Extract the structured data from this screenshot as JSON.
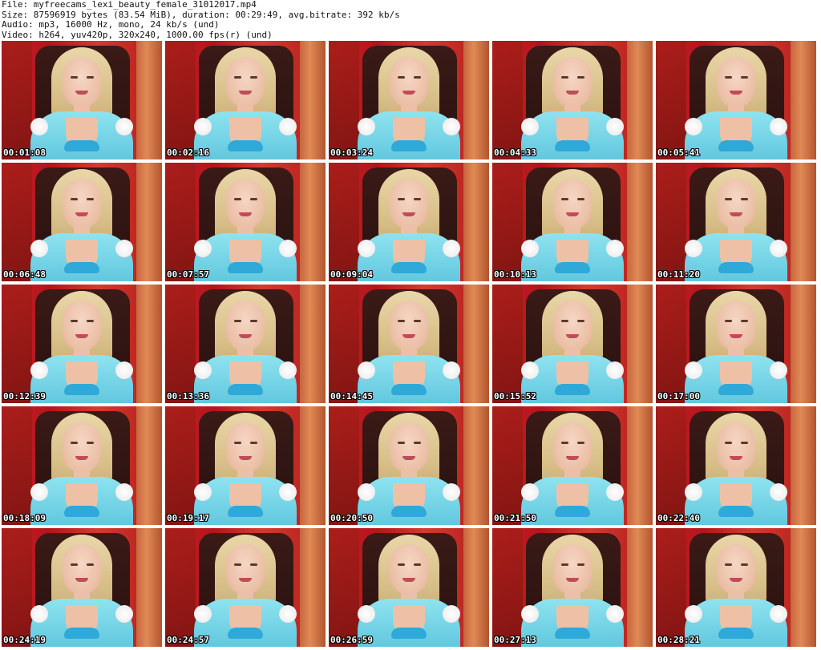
{
  "header": {
    "file": "File: myfreecams_lexi_beauty_female_31012017.mp4",
    "size": "Size: 87596919 bytes (83.54 MiB), duration: 00:29:49, avg.bitrate: 392 kb/s",
    "audio": "Audio: mp3, 16000 Hz, mono, 24 kb/s (und)",
    "video": "Video: h264, yuv420p, 320x240, 1000.00 fps(r) (und)"
  },
  "thumbnails": [
    {
      "timestamp": "00:01:08"
    },
    {
      "timestamp": "00:02:16"
    },
    {
      "timestamp": "00:03:24"
    },
    {
      "timestamp": "00:04:33"
    },
    {
      "timestamp": "00:05:41"
    },
    {
      "timestamp": "00:06:48"
    },
    {
      "timestamp": "00:07:57"
    },
    {
      "timestamp": "00:09:04"
    },
    {
      "timestamp": "00:10:13"
    },
    {
      "timestamp": "00:11:20"
    },
    {
      "timestamp": "00:12:39"
    },
    {
      "timestamp": "00:13:36"
    },
    {
      "timestamp": "00:14:45"
    },
    {
      "timestamp": "00:15:52"
    },
    {
      "timestamp": "00:17:00"
    },
    {
      "timestamp": "00:18:09"
    },
    {
      "timestamp": "00:19:17"
    },
    {
      "timestamp": "00:20:50"
    },
    {
      "timestamp": "00:21:50"
    },
    {
      "timestamp": "00:22:40"
    },
    {
      "timestamp": "00:24:19"
    },
    {
      "timestamp": "00:24:57"
    },
    {
      "timestamp": "00:26:59"
    },
    {
      "timestamp": "00:27:13"
    },
    {
      "timestamp": "00:28:21"
    }
  ],
  "colors": {
    "background": "#ffffff",
    "header_text": "#111111",
    "timestamp_text": "#ffffff",
    "timestamp_outline": "#000000"
  }
}
